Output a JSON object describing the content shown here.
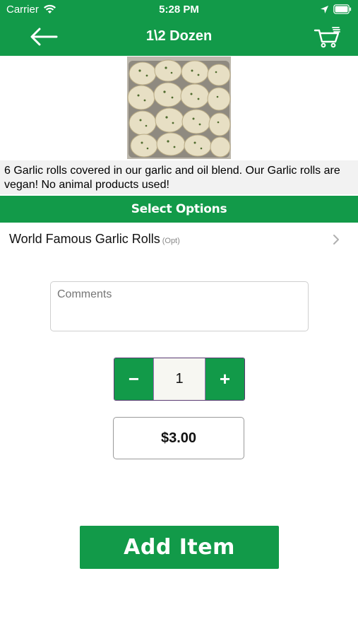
{
  "status_bar": {
    "carrier": "Carrier",
    "time": "5:28 PM"
  },
  "nav": {
    "title": "1\\2 Dozen",
    "back_icon": "arrow-left-icon",
    "cart_icon": "shopping-cart-icon"
  },
  "product": {
    "image_alt": "product-photo",
    "description": "6 Garlic rolls covered in our garlic and oil blend. Our Garlic rolls are vegan! No animal products used!"
  },
  "options": {
    "section_title": "Select Options",
    "items": [
      {
        "label": "World Famous Garlic Rolls",
        "tag": "(Opt)"
      }
    ]
  },
  "comments": {
    "placeholder": "Comments",
    "value": ""
  },
  "quantity": {
    "decrement_label": "−",
    "value": "1",
    "increment_label": "+"
  },
  "price": {
    "value": "$3.00"
  },
  "actions": {
    "add_label": "Add Item"
  },
  "colors": {
    "brand_green": "#129a49",
    "stepper_border": "#5a3a72"
  }
}
